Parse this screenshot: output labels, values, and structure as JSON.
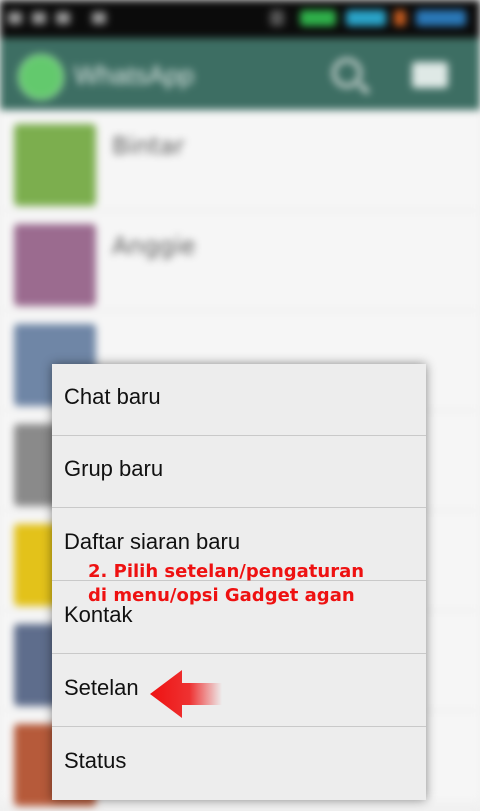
{
  "appbar": {
    "title": "WhatsApp"
  },
  "chats": [
    {
      "name": "Bintar",
      "time": "",
      "preview": "",
      "avatar_color": "#7cae4e"
    },
    {
      "name": "Anggie",
      "time": "",
      "preview": "",
      "avatar_color": "#9b6b8f"
    },
    {
      "name": "",
      "time": "",
      "preview": "",
      "avatar_color": "#6f86a6"
    },
    {
      "name": "",
      "time": "",
      "preview": "",
      "avatar_color": "#8a8a8a"
    },
    {
      "name": "",
      "time": "",
      "preview": "",
      "avatar_color": "#e3c21a"
    },
    {
      "name": "",
      "time": "",
      "preview": "",
      "avatar_color": "#5e6d8c"
    },
    {
      "name": "",
      "time": "",
      "preview": "",
      "avatar_color": "#b65a3a"
    }
  ],
  "menu": {
    "items": [
      {
        "label": "Chat baru"
      },
      {
        "label": "Grup baru"
      },
      {
        "label": "Daftar siaran baru"
      },
      {
        "label": "Kontak"
      },
      {
        "label": "Setelan"
      },
      {
        "label": "Status"
      }
    ]
  },
  "annotation": {
    "line1": "2. Pilih setelan/pengaturan",
    "line2": "di menu/opsi Gadget agan",
    "color": "#ee1111"
  },
  "colors": {
    "appbar": "#3d6e63",
    "accent": "#63c96d",
    "menu_bg": "#ededed"
  }
}
